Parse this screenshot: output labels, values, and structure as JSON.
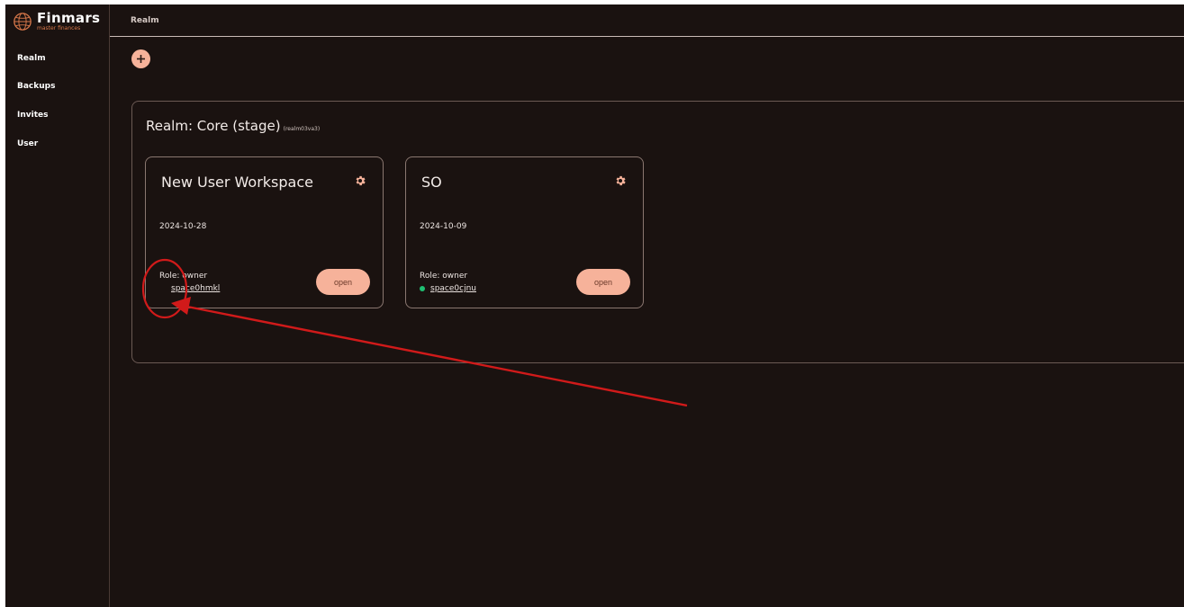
{
  "app": {
    "logo_name": "Finmars",
    "logo_tagline": "master finances"
  },
  "sidebar": {
    "items": [
      {
        "label": "Realm"
      },
      {
        "label": "Backups"
      },
      {
        "label": "Invites"
      },
      {
        "label": "User"
      }
    ]
  },
  "header": {
    "breadcrumb": "Realm"
  },
  "realm": {
    "title": "Realm: Core (stage)",
    "code": "(realm03va3)",
    "workspaces": [
      {
        "title": "New User Workspace",
        "date": "2024-10-28",
        "role": "Role: owner",
        "space": "space0hmkl",
        "status": "none",
        "open_label": "open"
      },
      {
        "title": "SO",
        "date": "2024-10-09",
        "role": "Role: owner",
        "space": "space0cjnu",
        "status": "online",
        "open_label": "open"
      }
    ]
  },
  "colors": {
    "background": "#1a1210",
    "accent": "#f6b29a",
    "status_online": "#1fbf72",
    "annotation": "#d11a1a"
  }
}
